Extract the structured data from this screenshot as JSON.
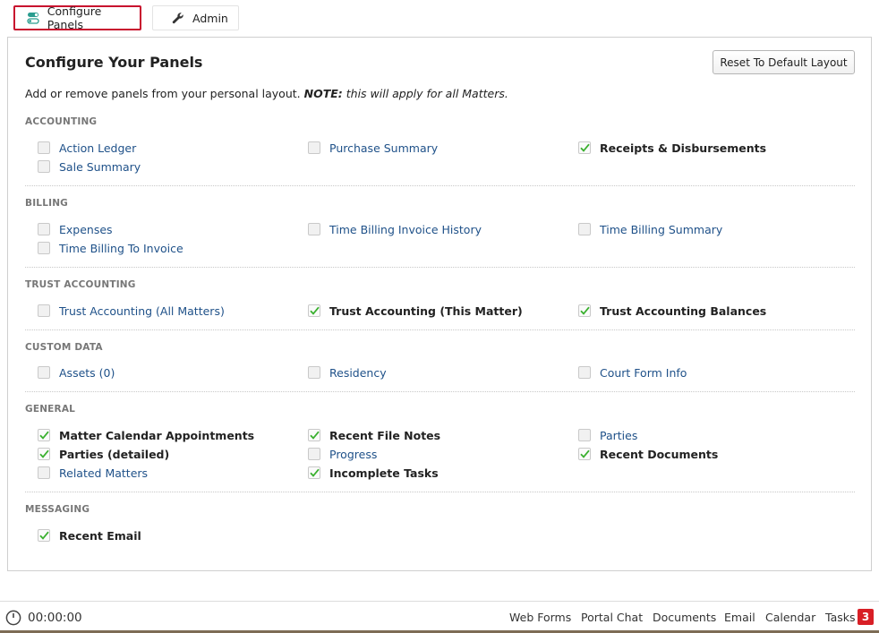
{
  "tabs": {
    "configure_label": "Configure Panels",
    "admin_label": "Admin"
  },
  "panel": {
    "title": "Configure Your Panels",
    "reset_label": "Reset To Default Layout",
    "desc_prefix": "Add or remove panels from your personal layout.",
    "desc_note": "NOTE:",
    "desc_rest": "this will apply for all Matters."
  },
  "sections": {
    "accounting": {
      "title": "ACCOUNTING",
      "items": [
        {
          "label": "Action Ledger",
          "checked": false
        },
        {
          "label": "Purchase Summary",
          "checked": false
        },
        {
          "label": "Receipts & Disbursements",
          "checked": true
        },
        {
          "label": "Sale Summary",
          "checked": false
        }
      ]
    },
    "billing": {
      "title": "BILLING",
      "items": [
        {
          "label": "Expenses",
          "checked": false
        },
        {
          "label": "Time Billing Invoice History",
          "checked": false
        },
        {
          "label": "Time Billing Summary",
          "checked": false
        },
        {
          "label": "Time Billing To Invoice",
          "checked": false
        }
      ]
    },
    "trust": {
      "title": "TRUST ACCOUNTING",
      "items": [
        {
          "label": "Trust Accounting (All Matters)",
          "checked": false
        },
        {
          "label": "Trust Accounting (This Matter)",
          "checked": true
        },
        {
          "label": "Trust Accounting Balances",
          "checked": true
        }
      ]
    },
    "custom": {
      "title": "CUSTOM DATA",
      "items": [
        {
          "label": "Assets (0)",
          "checked": false
        },
        {
          "label": "Residency",
          "checked": false
        },
        {
          "label": "Court Form Info",
          "checked": false
        }
      ]
    },
    "general": {
      "title": "GENERAL",
      "items": [
        {
          "label": "Matter Calendar Appointments",
          "checked": true
        },
        {
          "label": "Recent File Notes",
          "checked": true
        },
        {
          "label": "Parties",
          "checked": false
        },
        {
          "label": "Parties (detailed)",
          "checked": true
        },
        {
          "label": "Progress",
          "checked": false
        },
        {
          "label": "Recent Documents",
          "checked": true
        },
        {
          "label": "Related Matters",
          "checked": false
        },
        {
          "label": "Incomplete Tasks",
          "checked": true
        }
      ]
    },
    "messaging": {
      "title": "MESSAGING",
      "items": [
        {
          "label": "Recent Email",
          "checked": true
        }
      ]
    }
  },
  "footer": {
    "timer": "00:00:00",
    "links": [
      "Web Forms",
      "Portal Chat",
      "Documents",
      "Email",
      "Calendar",
      "Tasks"
    ],
    "tasks_badge": "3"
  }
}
